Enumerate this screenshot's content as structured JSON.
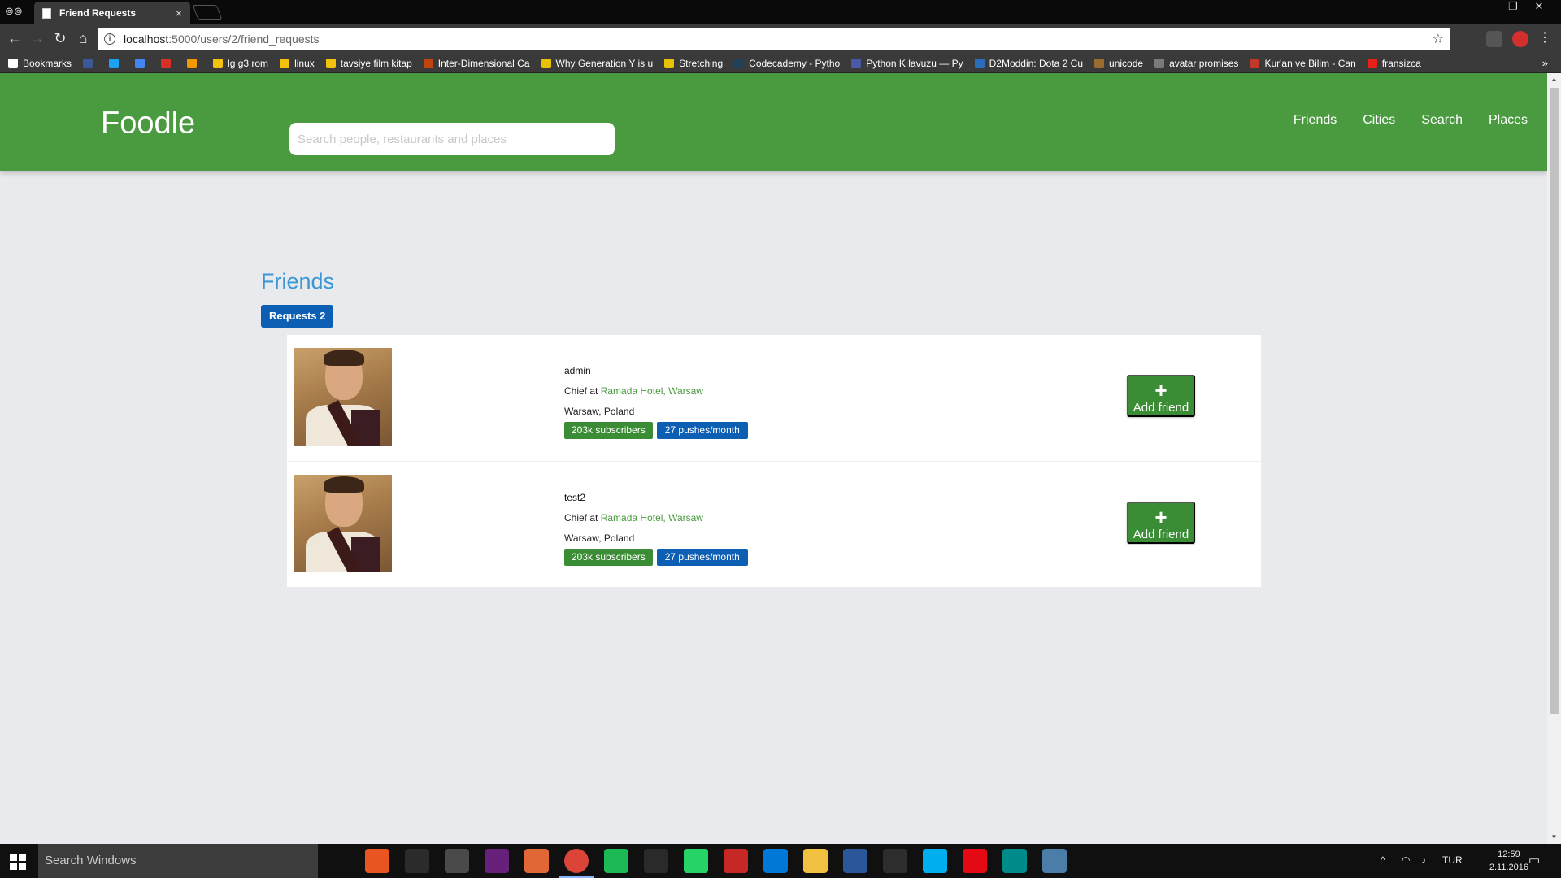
{
  "browser": {
    "tab_title": "Friend Requests",
    "tab_close": "×",
    "url_host": "localhost",
    "url_path": ":5000/users/2/friend_requests",
    "bookmarks": [
      {
        "label": "Bookmarks",
        "color": "#ffffff"
      },
      {
        "label": "",
        "color": "#3b5998"
      },
      {
        "label": "",
        "color": "#1da1f2"
      },
      {
        "label": "",
        "color": "#4285f4"
      },
      {
        "label": "",
        "color": "#d93025"
      },
      {
        "label": "",
        "color": "#f29900"
      },
      {
        "label": "lg g3 rom",
        "color": "#f4c20d"
      },
      {
        "label": "linux",
        "color": "#f4c20d"
      },
      {
        "label": "tavsiye film kitap",
        "color": "#f4c20d"
      },
      {
        "label": "Inter-Dimensional Ca",
        "color": "#c1440e"
      },
      {
        "label": "Why Generation Y is u",
        "color": "#e8c200"
      },
      {
        "label": "Stretching",
        "color": "#e8c200"
      },
      {
        "label": "Codecademy - Pytho",
        "color": "#1f4056"
      },
      {
        "label": "Python Kılavuzu — Py",
        "color": "#4b5aa8"
      },
      {
        "label": "D2Moddin: Dota 2 Cu",
        "color": "#2a6ebb"
      },
      {
        "label": "unicode",
        "color": "#9c6b2f"
      },
      {
        "label": "avatar promises",
        "color": "#7a7a7a"
      },
      {
        "label": "Kur'an ve Bilim - Can",
        "color": "#c0392b"
      },
      {
        "label": "fransizca",
        "color": "#e62117"
      }
    ],
    "bookmarks_overflow": "»"
  },
  "header": {
    "brand": "Foodle",
    "search_placeholder": "Search people, restaurants and places",
    "nav": [
      "Friends",
      "Cities",
      "Search",
      "Places"
    ]
  },
  "main": {
    "title": "Friends",
    "requests_label": "Requests 2",
    "requests": [
      {
        "username": "admin",
        "job_prefix": "Chief at ",
        "job_place": "Ramada Hotel, Warsaw",
        "location": "Warsaw, Poland",
        "subscribers": "203k subscribers",
        "pushes": "27 pushes/month",
        "button_icon": "+",
        "button_label": "Add friend"
      },
      {
        "username": "test2",
        "job_prefix": "Chief at ",
        "job_place": "Ramada Hotel, Warsaw",
        "location": "Warsaw, Poland",
        "subscribers": "203k subscribers",
        "pushes": "27 pushes/month",
        "button_icon": "+",
        "button_label": "Add friend"
      }
    ]
  },
  "taskbar": {
    "search_text": "Search Windows",
    "language": "TUR",
    "time": "12:59",
    "date": "2.11.2016",
    "apps": [
      {
        "name": "task-view",
        "color": "#101010"
      },
      {
        "name": "ubuntu",
        "color": "#e95420"
      },
      {
        "name": "terminal",
        "color": "#2b2b2b"
      },
      {
        "name": "sublime",
        "color": "#4a4a4a"
      },
      {
        "name": "visual-studio",
        "color": "#68217a"
      },
      {
        "name": "matlab",
        "color": "#e16737"
      },
      {
        "name": "chrome",
        "color": "#db4437"
      },
      {
        "name": "spotify",
        "color": "#1db954"
      },
      {
        "name": "media",
        "color": "#2a2a2a"
      },
      {
        "name": "whatsapp",
        "color": "#25d366"
      },
      {
        "name": "popcorn",
        "color": "#c62828"
      },
      {
        "name": "edge",
        "color": "#0078d7"
      },
      {
        "name": "explorer",
        "color": "#f0c040"
      },
      {
        "name": "word",
        "color": "#2b579a"
      },
      {
        "name": "store",
        "color": "#2d2d2d"
      },
      {
        "name": "skype",
        "color": "#00aff0"
      },
      {
        "name": "netflix",
        "color": "#e50914"
      },
      {
        "name": "camera",
        "color": "#008b8b"
      },
      {
        "name": "photos",
        "color": "#4a7ea8"
      }
    ]
  }
}
